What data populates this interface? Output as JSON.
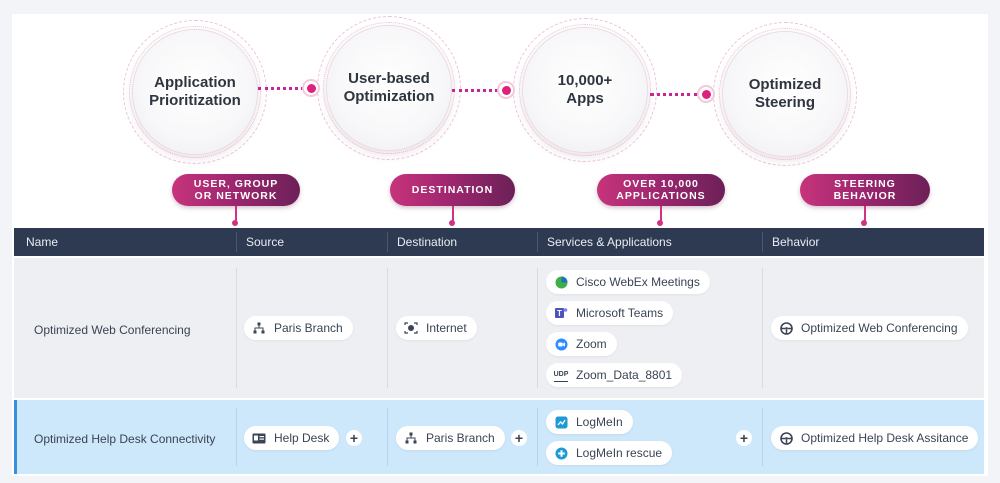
{
  "features": {
    "app_prioritization": "Application Prioritization",
    "user_based": "User-based Optimization",
    "apps": "10,000+ Apps",
    "steering": "Optimized Steering"
  },
  "pills": {
    "user_group_1": "USER, GROUP",
    "user_group_2": "OR NETWORK",
    "destination": "DESTINATION",
    "over_apps_1": "OVER 10,000",
    "over_apps_2": "APPLICATIONS",
    "steering_1": "STEERING",
    "steering_2": "BEHAVIOR"
  },
  "table": {
    "columns": [
      "Name",
      "Source",
      "Destination",
      "Services & Applications",
      "Behavior"
    ],
    "rows": [
      {
        "name": "Optimized Web Conferencing",
        "source": {
          "label": "Paris Branch",
          "icon": "network-icon"
        },
        "destination": {
          "label": "Internet",
          "icon": "internet-icon"
        },
        "services": [
          {
            "label": "Cisco WebEx Meetings",
            "icon": "webex-icon"
          },
          {
            "label": "Microsoft Teams",
            "icon": "teams-icon"
          },
          {
            "label": "Zoom",
            "icon": "zoom-icon"
          },
          {
            "label": "Zoom_Data_8801",
            "icon": "udp-icon",
            "icon_text": "UDP"
          }
        ],
        "behavior": {
          "label": "Optimized Web Conferencing",
          "icon": "steering-wheel-icon"
        }
      },
      {
        "name": "Optimized Help Desk Connectivity",
        "source": {
          "label": "Help Desk",
          "icon": "user-card-icon"
        },
        "destination": {
          "label": "Paris Branch",
          "icon": "network-icon"
        },
        "services": [
          {
            "label": "LogMeIn",
            "icon": "logmein-icon"
          },
          {
            "label": "LogMeIn rescue",
            "icon": "logmein-rescue-icon"
          }
        ],
        "behavior": {
          "label": "Optimized Help Desk Assitance",
          "icon": "steering-wheel-icon"
        }
      }
    ]
  },
  "plus_label": "+",
  "colors": {
    "header_bg": "#2d3a52",
    "accent_magenta": "#e0217a",
    "selected_row": "#cde7fb",
    "pill_gradient_start": "#c6347b",
    "pill_gradient_end": "#6c2058"
  }
}
